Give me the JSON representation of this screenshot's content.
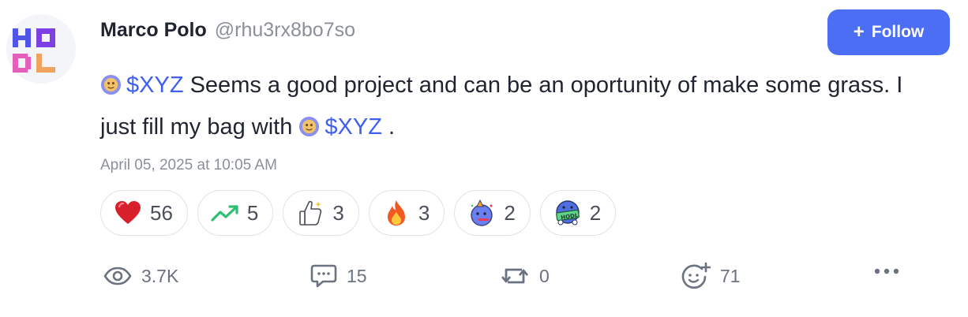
{
  "author": {
    "avatar_text": "HODL",
    "name": "Marco Polo",
    "handle": "@rhu3rx8bo7so"
  },
  "follow_button": {
    "label": "Follow",
    "icon": "plus-icon"
  },
  "post": {
    "segments": [
      {
        "type": "token",
        "icon": "token-coin-icon",
        "text": "$XYZ"
      },
      {
        "type": "text",
        "text": " Seems a good project and can be an oportunity of make some grass. I just fill my bag with "
      },
      {
        "type": "token",
        "icon": "token-coin-icon",
        "text": "$XYZ"
      },
      {
        "type": "text",
        "text": " ."
      }
    ]
  },
  "timestamp": "April 05, 2025 at 10:05 AM",
  "reactions": [
    {
      "icon": "red-heart-icon",
      "count": "56"
    },
    {
      "icon": "trending-up-icon",
      "count": "5"
    },
    {
      "icon": "thumbs-up-icon",
      "count": "3"
    },
    {
      "icon": "fire-icon",
      "count": "3"
    },
    {
      "icon": "party-blob-icon",
      "count": "2"
    },
    {
      "icon": "hodl-blob-icon",
      "count": "2"
    }
  ],
  "stats": {
    "views": "3.7K",
    "comments": "15",
    "reposts": "0",
    "tips": "71"
  },
  "colors": {
    "accent": "#4c6ef5",
    "ticker": "#3f5ff0",
    "muted": "#8a8f99"
  }
}
